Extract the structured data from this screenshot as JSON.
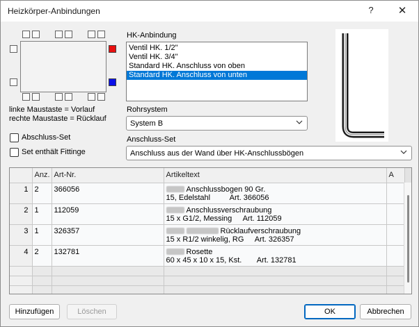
{
  "window": {
    "title": "Heizkörper-Anbindungen",
    "help_glyph": "?",
    "close_glyph": "✕"
  },
  "diagram": {
    "hint_left": "linke Maustaste = Vorlauf",
    "hint_right": "rechte Maustaste = Rücklauf",
    "supply_color": "#e81010",
    "return_color": "#0a10e8"
  },
  "options": {
    "abschluss_set_label": "Abschluss-Set",
    "set_fittings_label": "Set enthält Fittinge"
  },
  "hk_anbindung": {
    "label": "HK-Anbindung",
    "items": [
      "Ventil HK. 1/2\"",
      "Ventil HK. 3/4\"",
      "Standard HK. Anschluss von oben",
      "Standard HK. Anschluss von unten"
    ],
    "selected_index": 3
  },
  "rohrsystem": {
    "label": "Rohrsystem",
    "value": "System B"
  },
  "anschluss_set": {
    "label": "Anschluss-Set",
    "value": "Anschluss aus der Wand über HK-Anschlussbögen"
  },
  "table": {
    "headers": [
      "",
      "Anz.",
      "Art-Nr.",
      "Artikeltext",
      "A"
    ],
    "rows": [
      {
        "num": "1",
        "anz": "2",
        "artnr": "366056",
        "line1": "Anschlussbogen 90 Gr.",
        "line2": "15, Edelstahl",
        "art": "Art. 366056"
      },
      {
        "num": "2",
        "anz": "1",
        "artnr": "112059",
        "line1": "Anschlussverschraubung",
        "line2": "15 x G1/2, Messing",
        "art": "Art. 112059"
      },
      {
        "num": "3",
        "anz": "1",
        "artnr": "326357",
        "line1": "Rücklaufverschraubung",
        "line2": "15 x R1/2 winkelig, RG",
        "art": "Art. 326357"
      },
      {
        "num": "4",
        "anz": "2",
        "artnr": "132781",
        "line1": "Rosette",
        "line2": "60 x 45 x 10 x 15, Kst.",
        "art": "Art. 132781"
      }
    ]
  },
  "buttons": {
    "add": "Hinzufügen",
    "delete": "Löschen",
    "ok": "OK",
    "cancel": "Abbrechen"
  }
}
